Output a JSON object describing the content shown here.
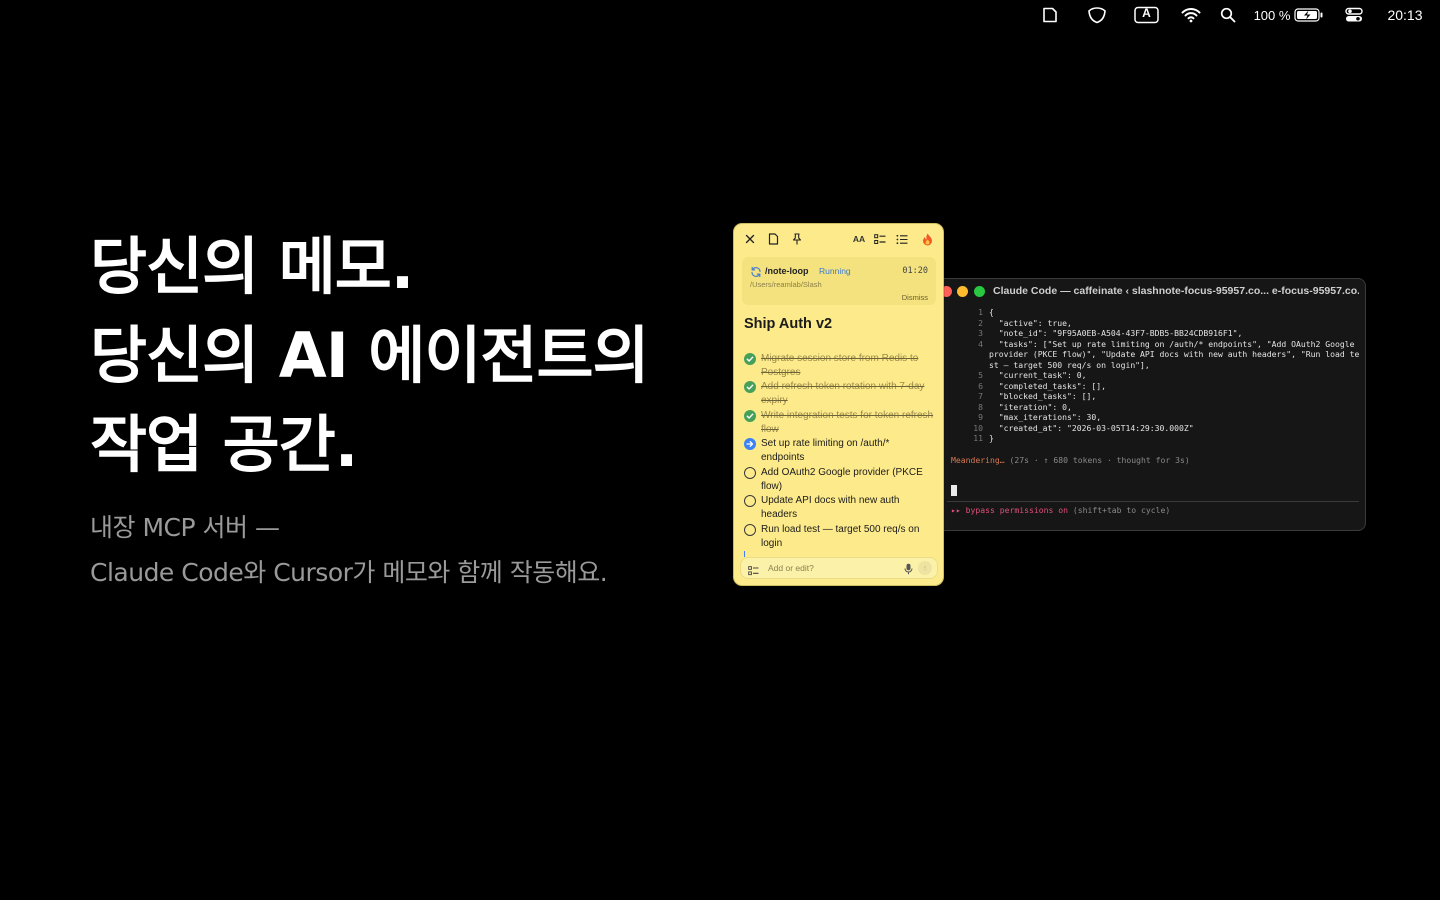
{
  "menubar": {
    "icons": [
      "note-icon",
      "shield-icon",
      "input-source-icon",
      "wifi-icon",
      "search-icon",
      "battery-icon",
      "control-center-icon"
    ],
    "input_source_letter": "A",
    "battery_percent": "100 %",
    "clock": "20:13"
  },
  "hero": {
    "lines": [
      "당신의 메모.",
      "당신의 AI 에이전트의",
      "작업 공간."
    ],
    "sub_lines": [
      "내장 MCP 서버 —",
      "Claude Code와 Cursor가 메모와 함께 작동해요."
    ]
  },
  "terminal": {
    "title": "Claude Code — caffeinate ‹ slashnote-focus-95957.co... e-focus-95957.co...",
    "traffic_light_colors": [
      "#ff5f57",
      "#febc2e",
      "#28c840"
    ],
    "code_lines": [
      {
        "n": "1",
        "text": "{"
      },
      {
        "n": "2",
        "text": "  \"active\": true,"
      },
      {
        "n": "3",
        "text": "  \"note_id\": \"9F95A0EB-A504-43F7-BDB5-BB24CDB916F1\","
      },
      {
        "n": "4",
        "text": "  \"tasks\": [\"Set up rate limiting on /auth/* endpoints\", \"Add OAuth2 Google provider (PKCE flow)\", \"Update API docs with new auth headers\", \"Run load test — target 500 req/s on login\"],"
      },
      {
        "n": "5",
        "text": "  \"current_task\": 0,"
      },
      {
        "n": "6",
        "text": "  \"completed_tasks\": [],"
      },
      {
        "n": "7",
        "text": "  \"blocked_tasks\": [],"
      },
      {
        "n": "8",
        "text": "  \"iteration\": 0,"
      },
      {
        "n": "9",
        "text": "  \"max_iterations\": 30,"
      },
      {
        "n": "10",
        "text": "  \"created_at\": \"2026-03-05T14:29:30.000Z\""
      },
      {
        "n": "11",
        "text": "}"
      }
    ],
    "status_word": "Meandering…",
    "status_detail": "(27s · ↑ 680 tokens · thought for 3s)",
    "bypass_label": "▸▸ bypass permissions on",
    "bypass_hint": "(shift+tab to cycle)",
    "accent_orange": "#d77a52",
    "accent_pink": "#e0507a"
  },
  "note": {
    "background": "#fdeb8b",
    "toolbar": {
      "icons": [
        "close-icon",
        "document-icon",
        "pin-icon",
        "text-size-icon",
        "checklist-icon",
        "list-icon",
        "flame-icon"
      ],
      "text_size_label": "AA"
    },
    "loop": {
      "command": "/note-loop",
      "state": "Running",
      "time": "01:20",
      "path": "/Users/reamlab/Slash",
      "dismiss": "Dismiss"
    },
    "title": "Ship Auth v2",
    "tasks": [
      {
        "text": "Migrate session store from Redis to Postgres",
        "status": "done"
      },
      {
        "text": "Add refresh token rotation with 7-day expiry",
        "status": "done"
      },
      {
        "text": "Write integration tests for token refresh flow",
        "status": "done"
      },
      {
        "text": "Set up rate limiting on /auth/* endpoints",
        "status": "active"
      },
      {
        "text": "Add OAuth2 Google provider (PKCE flow)",
        "status": "todo"
      },
      {
        "text": "Update API docs with new auth headers",
        "status": "todo"
      },
      {
        "text": "Run load test — target 500 req/s on login",
        "status": "todo"
      }
    ],
    "composer_placeholder": "Add or edit?"
  }
}
